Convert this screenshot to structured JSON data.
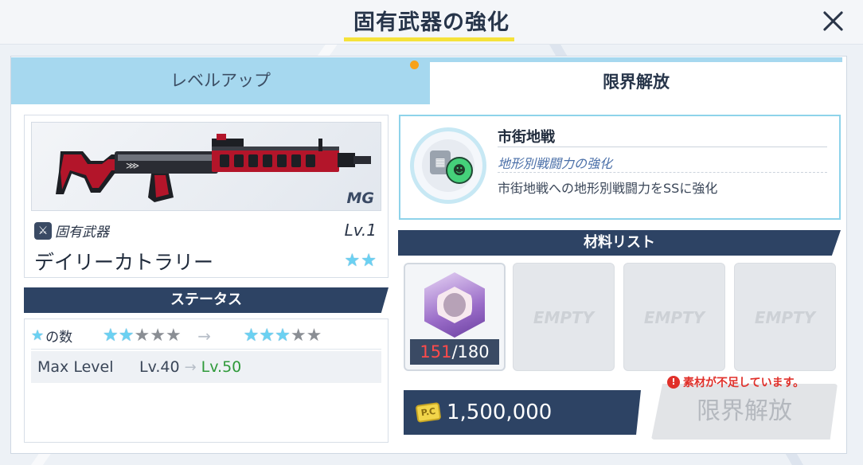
{
  "header": {
    "title": "固有武器の強化"
  },
  "tabs": [
    {
      "label": "レベルアップ",
      "active": false
    },
    {
      "label": "限界解放",
      "active": true
    }
  ],
  "weapon": {
    "class_tag": "MG",
    "type_label": "固有武器",
    "level": "Lv.1",
    "name": "デイリーカトラリー",
    "stars": 2
  },
  "status": {
    "section_label": "ステータス",
    "stars_label": "の数",
    "stars_before": {
      "filled": 2,
      "total": 5
    },
    "stars_after": {
      "filled": 3,
      "total": 5
    },
    "arrow": "→",
    "max_level_label": "Max Level",
    "max_level_old": "Lv.40",
    "max_level_arrow": "→",
    "max_level_new": "Lv.50"
  },
  "skill": {
    "title": "市街地戦",
    "subtitle": "地形別戦闘力の強化",
    "description": "市街地戦への地形別戦闘力をSSに強化"
  },
  "materials": {
    "section_label": "材料リスト",
    "items": [
      {
        "have": "151",
        "need": "/180"
      }
    ],
    "empty_label": "EMPTY"
  },
  "cost": {
    "value": "1,500,000",
    "coin_symbol": "P.C"
  },
  "warning": "素材が不足しています。",
  "limit_button_label": "限界解放",
  "colors": {
    "tab_inactive": "#a6d8ef",
    "section_bar": "#2d4364",
    "accent_yellow": "#f5e23a",
    "warning_red": "#e0302a",
    "level_green": "#2f9a3a"
  }
}
